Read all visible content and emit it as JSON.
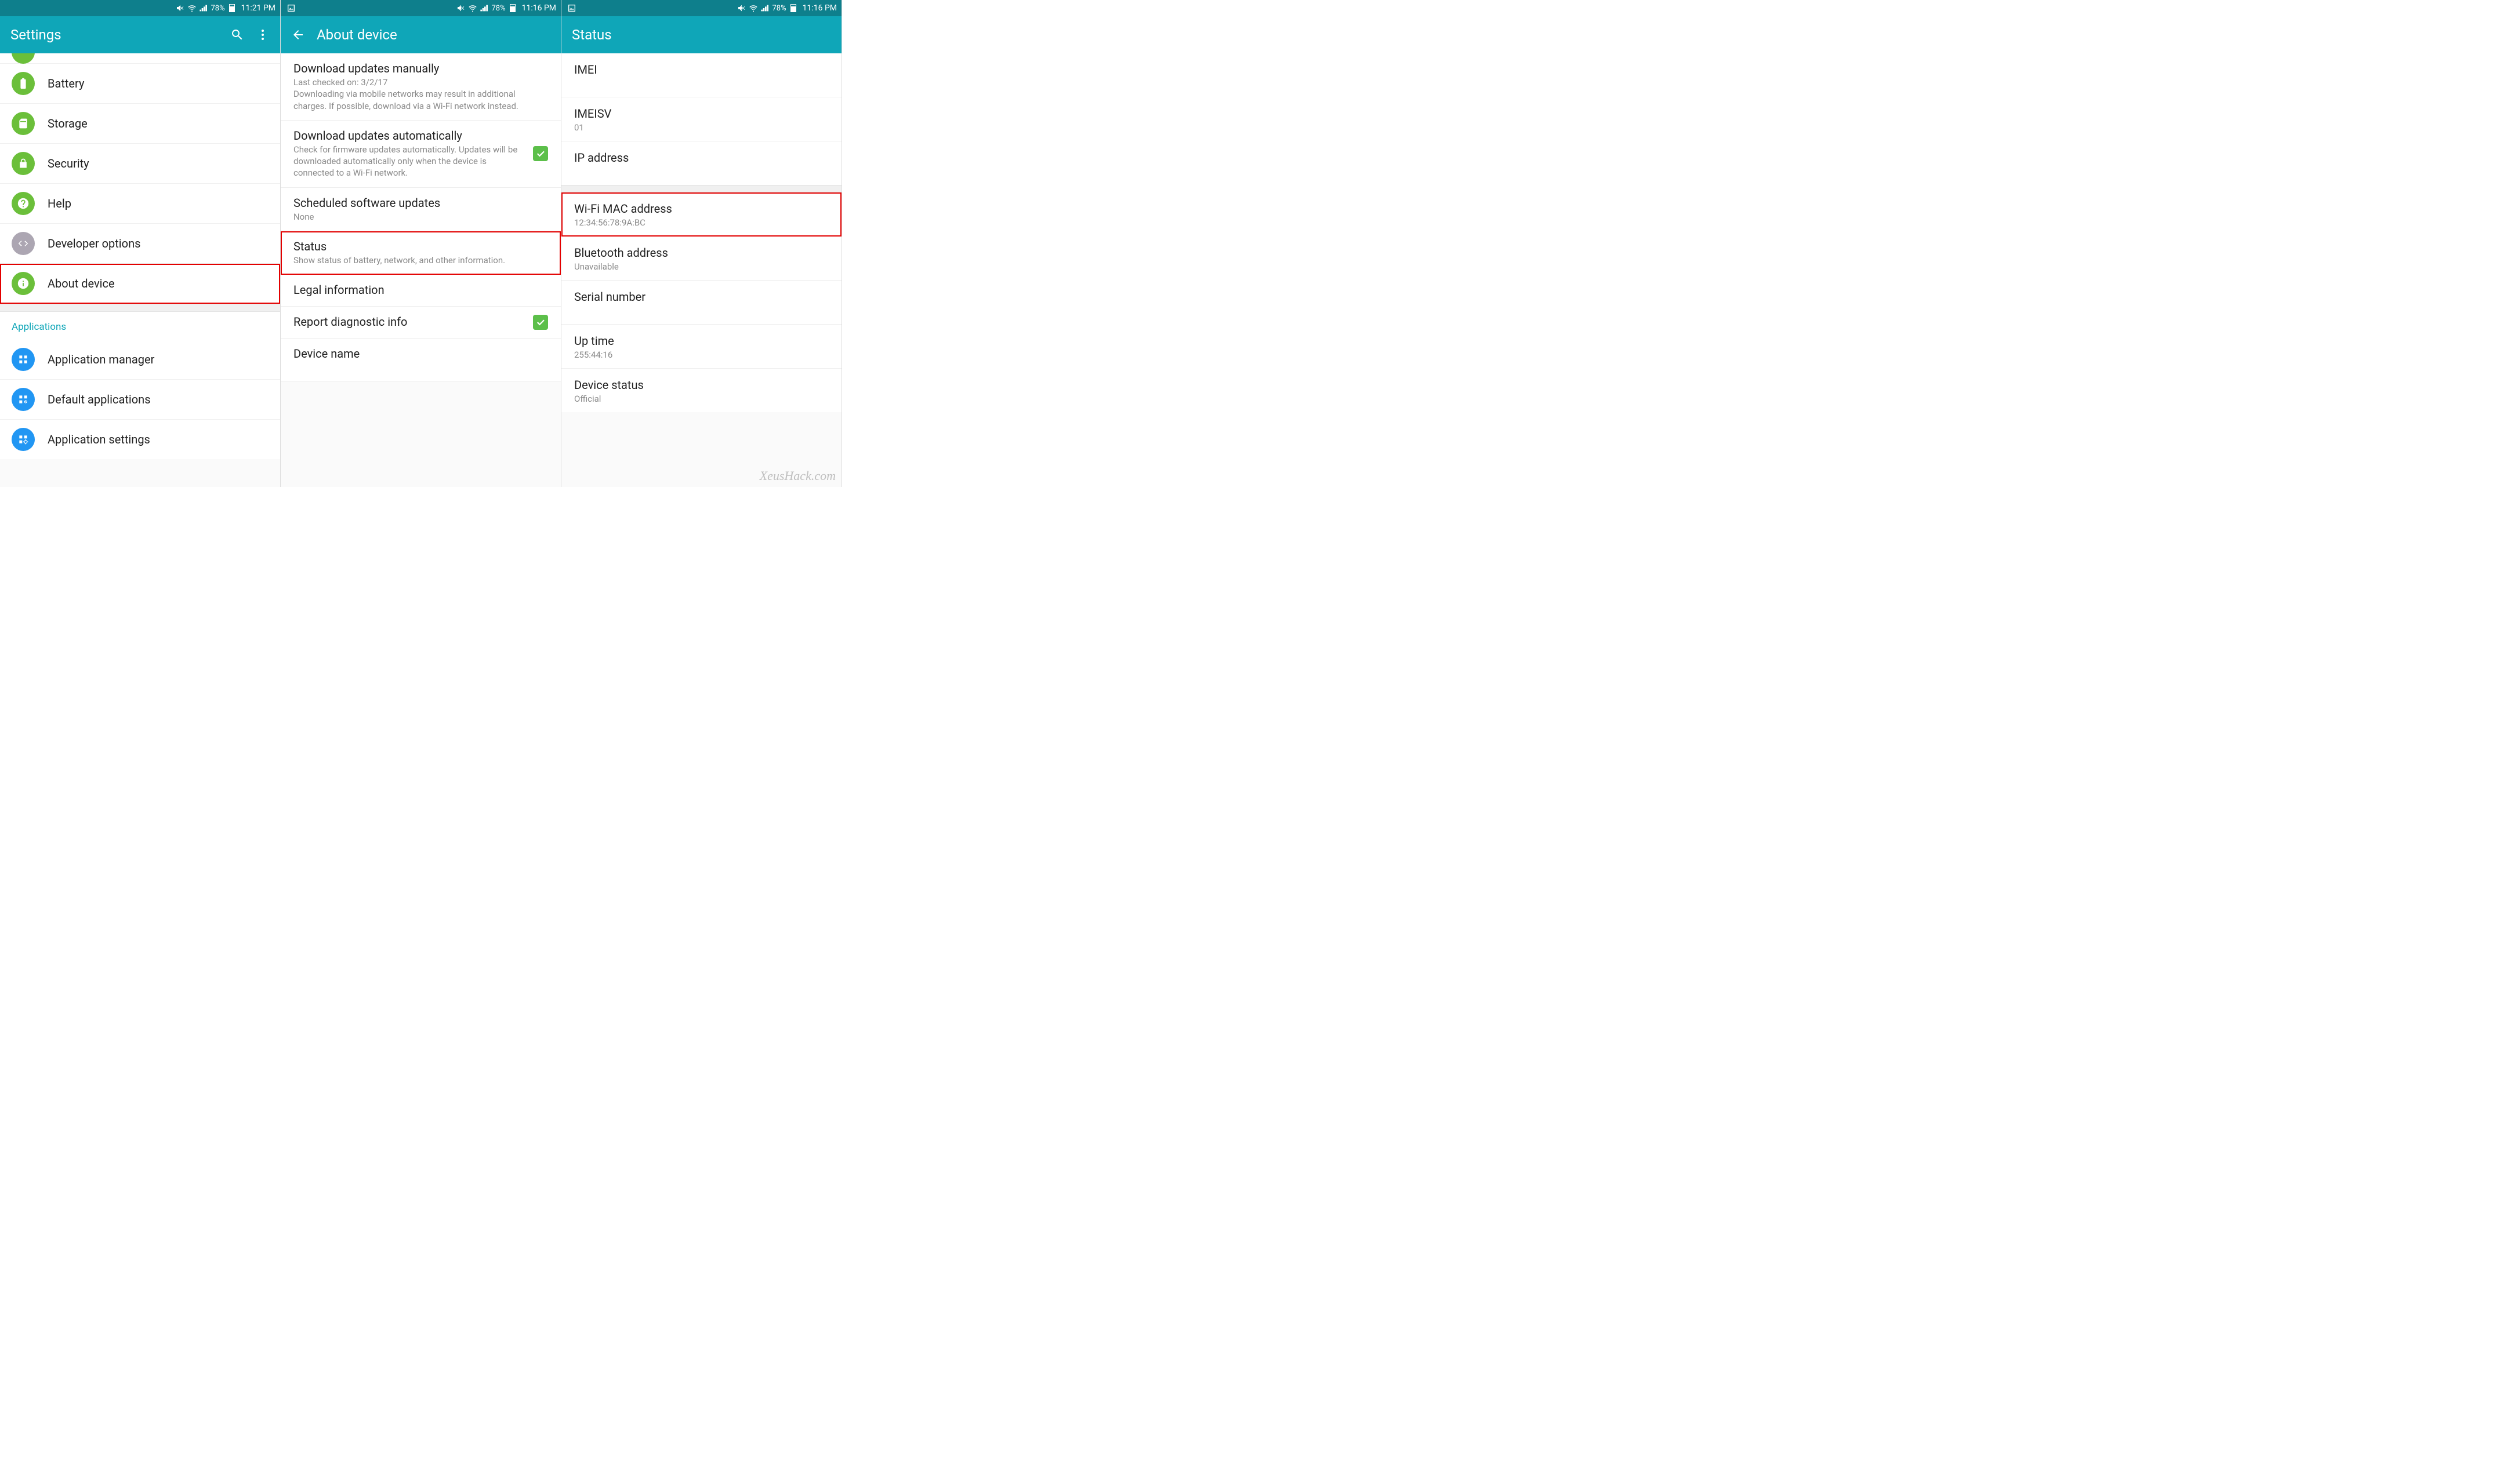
{
  "colors": {
    "teal": "#0fa6b8",
    "teal_dark": "#0e7f8c",
    "green": "#6bbf3a",
    "grey": "#aca6b2",
    "blue": "#2196f3",
    "check": "#5cbf4a",
    "red": "#e30000"
  },
  "screen1": {
    "status_bar": {
      "battery_pct": "78%",
      "time": "11:21 PM"
    },
    "title": "Settings",
    "items": [
      {
        "icon": "battery-icon",
        "color": "green",
        "label": "Battery"
      },
      {
        "icon": "storage-icon",
        "color": "green",
        "label": "Storage"
      },
      {
        "icon": "lock-icon",
        "color": "green",
        "label": "Security"
      },
      {
        "icon": "help-icon",
        "color": "green",
        "label": "Help"
      },
      {
        "icon": "code-icon",
        "color": "grey",
        "label": "Developer options"
      },
      {
        "icon": "info-icon",
        "color": "green",
        "label": "About device",
        "highlight": true
      }
    ],
    "section_header": "Applications",
    "app_items": [
      {
        "icon": "apps-grid-icon",
        "color": "blue",
        "label": "Application manager"
      },
      {
        "icon": "apps-default-icon",
        "color": "blue",
        "label": "Default applications"
      },
      {
        "icon": "apps-settings-icon",
        "color": "blue",
        "label": "Application settings"
      }
    ]
  },
  "screen2": {
    "status_bar": {
      "battery_pct": "78%",
      "time": "11:16 PM"
    },
    "title": "About device",
    "items": [
      {
        "title": "Download updates manually",
        "sub": "Last checked on: 3/2/17\nDownloading via mobile networks may result in additional charges. If possible, download via a Wi-Fi network instead."
      },
      {
        "title": "Download updates automatically",
        "sub": "Check for firmware updates automatically. Updates will be downloaded automatically only when the device is connected to a Wi-Fi network.",
        "checked": true
      },
      {
        "title": "Scheduled software updates",
        "sub": "None"
      },
      {
        "title": "Status",
        "sub": "Show status of battery, network, and other information.",
        "highlight": true
      },
      {
        "title": "Legal information"
      },
      {
        "title": "Report diagnostic info",
        "checked": true
      },
      {
        "title": "Device name"
      }
    ]
  },
  "screen3": {
    "status_bar": {
      "battery_pct": "78%",
      "time": "11:16 PM"
    },
    "title": "Status",
    "items_top": [
      {
        "title": "IMEI"
      },
      {
        "title": "IMEISV",
        "value": "01"
      },
      {
        "title": "IP address",
        "value": ""
      }
    ],
    "items_bottom": [
      {
        "title": "Wi-Fi MAC address",
        "value": "12:34:56:78:9A:BC",
        "highlight": true
      },
      {
        "title": "Bluetooth address",
        "value": "Unavailable"
      },
      {
        "title": "Serial number",
        "value": ""
      },
      {
        "title": "Up time",
        "value": "255:44:16"
      },
      {
        "title": "Device status",
        "value": "Official"
      }
    ]
  },
  "watermark": "XeusHack.com"
}
